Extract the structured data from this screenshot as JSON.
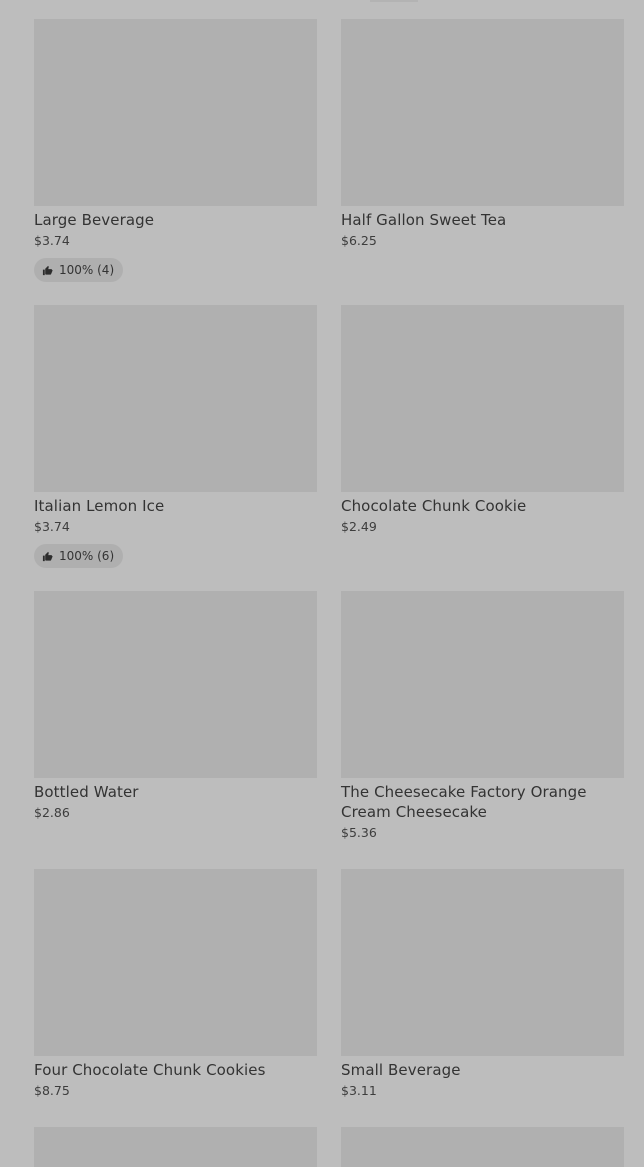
{
  "menu_items": [
    {
      "name": "Large Beverage",
      "price": "$3.74",
      "rating": "100% (4)"
    },
    {
      "name": "Half Gallon Sweet Tea",
      "price": "$6.25",
      "rating": null
    },
    {
      "name": "Italian Lemon Ice",
      "price": "$3.74",
      "rating": "100% (6)"
    },
    {
      "name": "Chocolate Chunk Cookie",
      "price": "$2.49",
      "rating": null
    },
    {
      "name": "Bottled Water",
      "price": "$2.86",
      "rating": null
    },
    {
      "name": "The Cheesecake Factory Orange Cream Cheesecake",
      "price": "$5.36",
      "rating": null
    },
    {
      "name": "Four Chocolate Chunk Cookies",
      "price": "$8.75",
      "rating": null
    },
    {
      "name": "Small Beverage",
      "price": "$3.11",
      "rating": null
    }
  ],
  "icons": {
    "rating": "thumbs-up-icon"
  }
}
